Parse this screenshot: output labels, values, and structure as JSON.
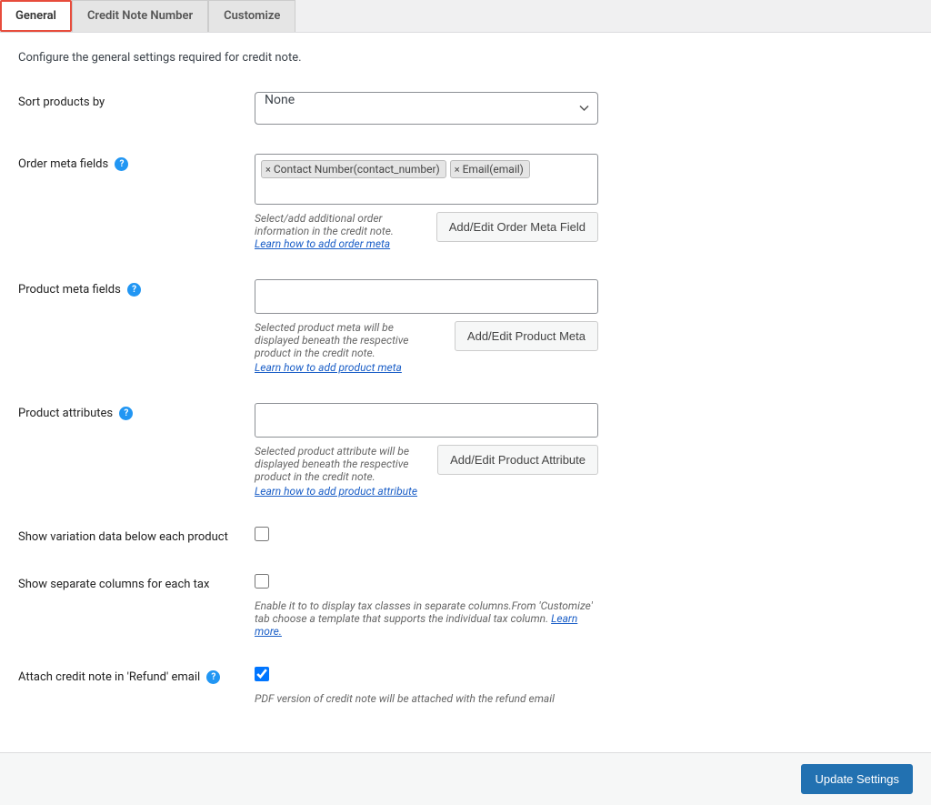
{
  "tabs": {
    "general": "General",
    "credit_note_number": "Credit Note Number",
    "customize": "Customize"
  },
  "intro": "Configure the general settings required for credit note.",
  "sort_products": {
    "label": "Sort products by",
    "selected": "None"
  },
  "order_meta": {
    "label": "Order meta fields",
    "chip1": "Contact Number(contact_number)",
    "chip2": "Email(email)",
    "hint_prefix": "Select/add additional order information in the credit note. ",
    "hint_link": "Learn how to add order meta",
    "button": "Add/Edit Order Meta Field"
  },
  "product_meta": {
    "label": "Product meta fields",
    "hint": "Selected product meta will be displayed beneath the respective product in the credit note.",
    "hint_link": "Learn how to add product meta",
    "button": "Add/Edit Product Meta"
  },
  "product_attr": {
    "label": "Product attributes",
    "hint": "Selected product attribute will be displayed beneath the respective product in the credit note.",
    "hint_link": "Learn how to add product attribute",
    "button": "Add/Edit Product Attribute"
  },
  "variation": {
    "label": "Show variation data below each product"
  },
  "tax_columns": {
    "label": "Show separate columns for each tax",
    "hint": "Enable it to to display tax classes in separate columns.From 'Customize' tab choose a template that supports the individual tax column. ",
    "hint_link": "Learn more."
  },
  "attach_refund": {
    "label": "Attach credit note in 'Refund' email",
    "hint": "PDF version of credit note will be attached with the refund email"
  },
  "footer": {
    "update": "Update Settings"
  }
}
